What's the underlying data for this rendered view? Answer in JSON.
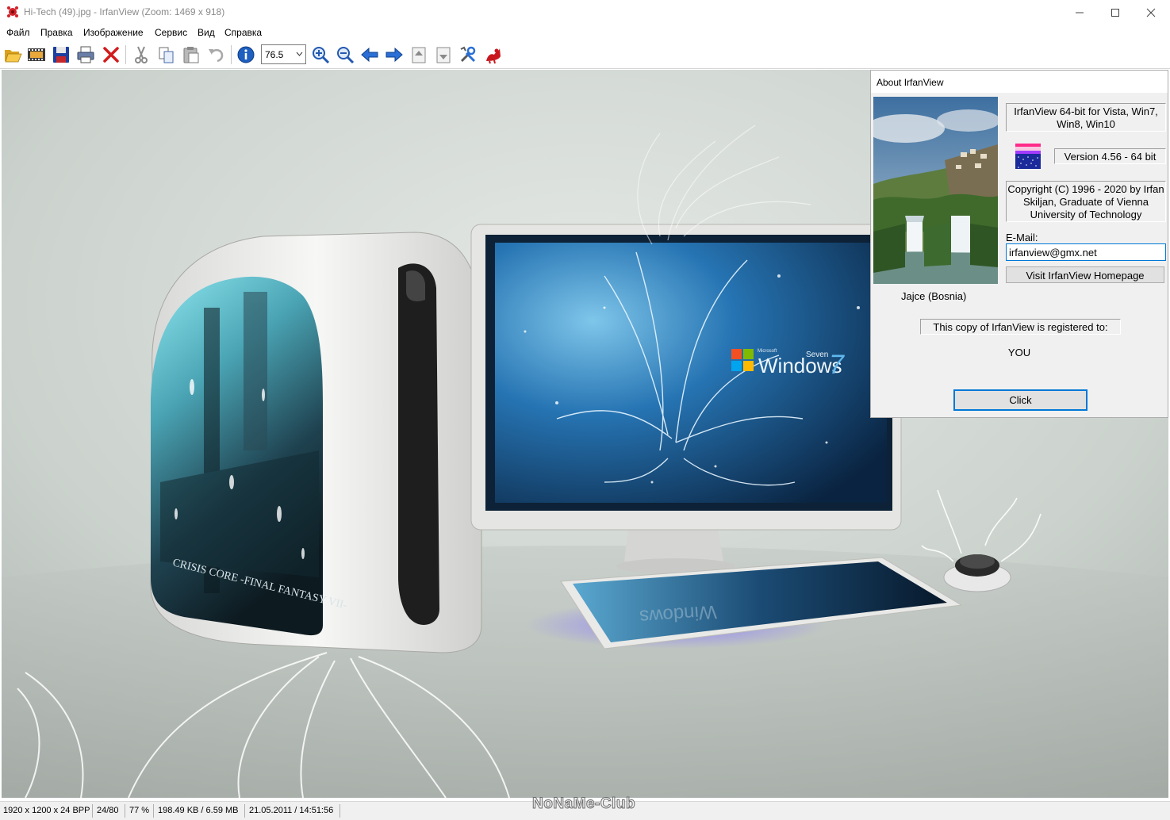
{
  "window": {
    "title": "Hi-Tech (49).jpg - IrfanView (Zoom: 1469 x 918)"
  },
  "menu": [
    "Файл",
    "Правка",
    "Изображение",
    "Сервис",
    "Вид",
    "Справка"
  ],
  "toolbar": {
    "zoom_value": "76.5"
  },
  "image_text": {
    "windows_brand": "Windows",
    "windows_seven": "Seven",
    "windows_version": "7",
    "windows_microsoft": "Microsoft",
    "case_text": "CRISIS CORE -FINAL FANTASY VII-"
  },
  "about": {
    "title": "About  IrfanView",
    "product": "IrfanView 64-bit for Vista, Win7, Win8, Win10",
    "version": "Version 4.56 - 64 bit",
    "copyright": "Copyright (C) 1996 - 2020 by Irfan Skiljan, Graduate of Vienna University of Technology",
    "email_label": "E-Mail:",
    "email": "irfanview@gmx.net",
    "homepage_button": "Visit IrfanView Homepage",
    "photo_caption": "Jajce (Bosnia)",
    "registered_label": "This copy of IrfanView is registered to:",
    "registered_to": "YOU",
    "ok_button": "Click"
  },
  "status": {
    "dimensions": "1920 x 1200 x 24 BPP",
    "index": "24/80",
    "zoom": "77 %",
    "filesize": "198.49 KB / 6.59 MB",
    "datetime": "21.05.2011 / 14:51:56"
  },
  "watermark": "NoNaMe-Club",
  "colors": {
    "accent": "#0078d7",
    "dialog_bg": "#f0f0f0"
  }
}
